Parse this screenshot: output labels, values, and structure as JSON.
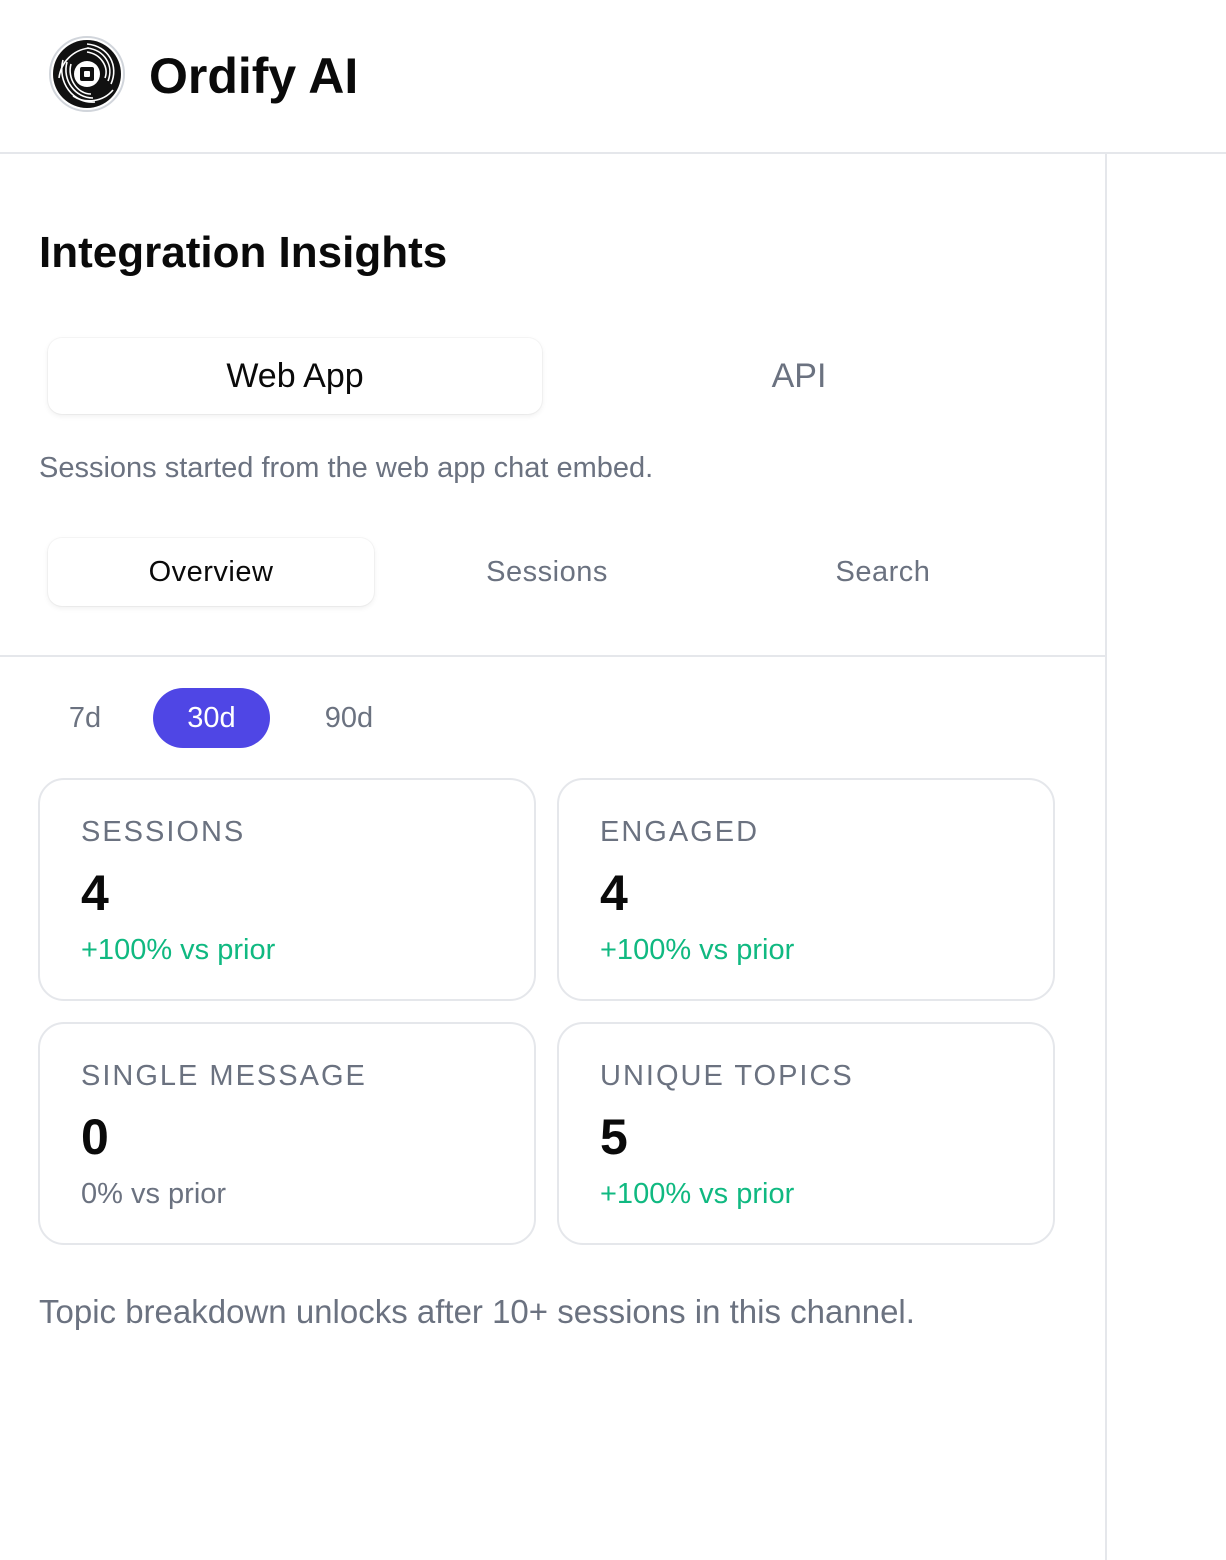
{
  "header": {
    "brand": "Ordify AI",
    "logo_icon": "swirl-logo-icon"
  },
  "page": {
    "title": "Integration Insights"
  },
  "channel_tabs": {
    "items": [
      {
        "label": "Web App",
        "active": true
      },
      {
        "label": "API",
        "active": false
      }
    ],
    "description": "Sessions started from the web app chat embed."
  },
  "sub_tabs": {
    "items": [
      {
        "label": "Overview",
        "active": true
      },
      {
        "label": "Sessions",
        "active": false
      },
      {
        "label": "Search",
        "active": false
      }
    ]
  },
  "periods": {
    "items": [
      {
        "label": "7d",
        "active": false
      },
      {
        "label": "30d",
        "active": true
      },
      {
        "label": "90d",
        "active": false
      }
    ]
  },
  "metrics": [
    {
      "label": "SESSIONS",
      "value": "4",
      "change": "+100% vs prior",
      "trend": "up"
    },
    {
      "label": "ENGAGED",
      "value": "4",
      "change": "+100% vs prior",
      "trend": "up"
    },
    {
      "label": "SINGLE MESSAGE",
      "value": "0",
      "change": "0% vs prior",
      "trend": "flat"
    },
    {
      "label": "UNIQUE TOPICS",
      "value": "5",
      "change": "+100% vs prior",
      "trend": "up"
    }
  ],
  "footnote": "Topic breakdown unlocks after 10+ sessions in this channel.",
  "colors": {
    "accent": "#4f46e5",
    "positive": "#10b981",
    "muted": "#6b7280",
    "border": "#e5e7eb"
  }
}
